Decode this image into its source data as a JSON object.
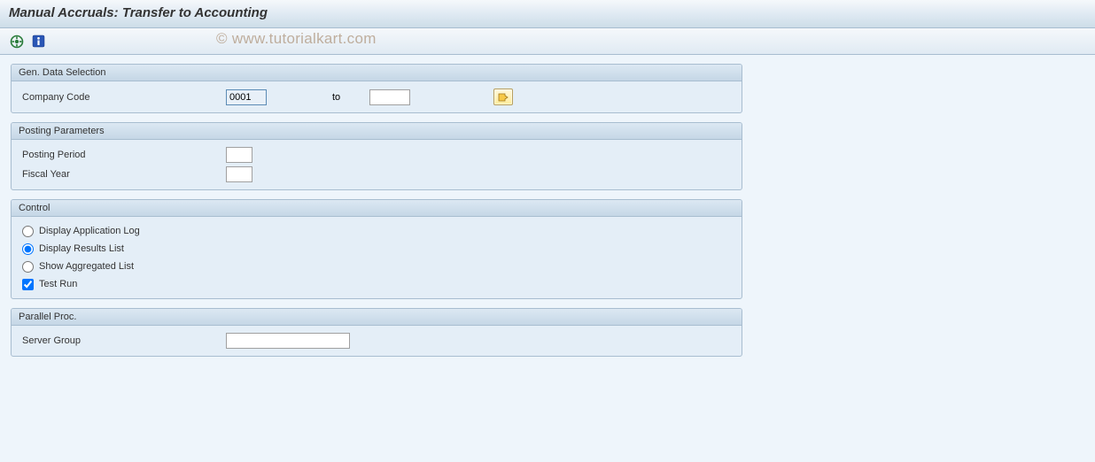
{
  "title": "Manual Accruals: Transfer to Accounting",
  "watermark": "© www.tutorialkart.com",
  "toolbar": {
    "execute_icon": "execute",
    "info_icon": "info"
  },
  "groups": {
    "gen_data": {
      "title": "Gen. Data Selection",
      "company_code_label": "Company Code",
      "company_code_from": "0001",
      "to_label": "to",
      "company_code_to": ""
    },
    "posting": {
      "title": "Posting Parameters",
      "posting_period_label": "Posting Period",
      "posting_period_value": "",
      "fiscal_year_label": "Fiscal Year",
      "fiscal_year_value": ""
    },
    "control": {
      "title": "Control",
      "display_app_log": "Display Application Log",
      "display_results": "Display Results List",
      "show_aggregated": "Show Aggregated List",
      "test_run": "Test Run",
      "selected_radio": "display_results",
      "test_run_checked": true
    },
    "parallel": {
      "title": "Parallel Proc.",
      "server_group_label": "Server Group",
      "server_group_value": ""
    }
  }
}
